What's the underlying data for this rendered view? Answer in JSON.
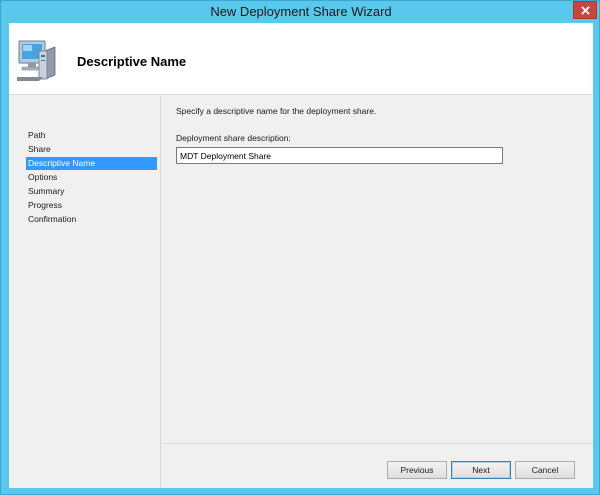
{
  "window": {
    "title": "New Deployment Share Wizard"
  },
  "header": {
    "title": "Descriptive Name",
    "icon": "computer-icon"
  },
  "steps": [
    {
      "label": "Path",
      "active": false
    },
    {
      "label": "Share",
      "active": false
    },
    {
      "label": "Descriptive Name",
      "active": true
    },
    {
      "label": "Options",
      "active": false
    },
    {
      "label": "Summary",
      "active": false
    },
    {
      "label": "Progress",
      "active": false
    },
    {
      "label": "Confirmation",
      "active": false
    }
  ],
  "main": {
    "instruction": "Specify a descriptive name for the deployment share.",
    "field_label": "Deployment share description:",
    "field_value": "MDT Deployment Share"
  },
  "buttons": {
    "previous": "Previous",
    "next": "Next",
    "cancel": "Cancel"
  },
  "colors": {
    "frame": "#5ac8ec",
    "selection": "#3399ff",
    "close": "#c7463d"
  }
}
